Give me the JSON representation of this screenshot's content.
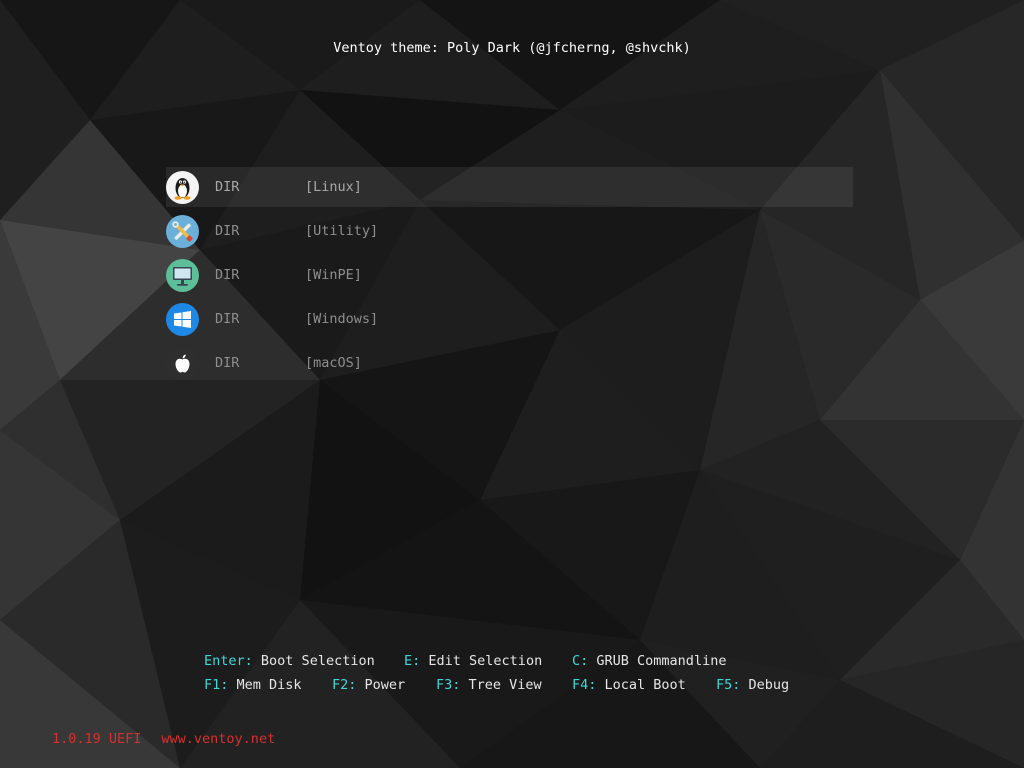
{
  "theme_title": "Ventoy theme: Poly Dark (@jfcherng, @shvchk)",
  "menu": {
    "items": [
      {
        "type": "DIR",
        "name": "[Linux]",
        "icon": "linux-tux-icon",
        "selected": true
      },
      {
        "type": "DIR",
        "name": "[Utility]",
        "icon": "tools-icon",
        "selected": false
      },
      {
        "type": "DIR",
        "name": "[WinPE]",
        "icon": "monitor-icon",
        "selected": false
      },
      {
        "type": "DIR",
        "name": "[Windows]",
        "icon": "windows-logo-icon",
        "selected": false
      },
      {
        "type": "DIR",
        "name": "[macOS]",
        "icon": "apple-logo-icon",
        "selected": false
      }
    ]
  },
  "hotkeys": {
    "row1": [
      {
        "key": "Enter:",
        "label": "Boot Selection"
      },
      {
        "key": "E:",
        "label": "Edit Selection"
      },
      {
        "key": "C:",
        "label": "GRUB Commandline"
      }
    ],
    "row2": [
      {
        "key": "F1:",
        "label": "Mem Disk"
      },
      {
        "key": "F2:",
        "label": "Power"
      },
      {
        "key": "F3:",
        "label": "Tree View"
      },
      {
        "key": "F4:",
        "label": "Local Boot"
      },
      {
        "key": "F5:",
        "label": "Debug"
      }
    ]
  },
  "footer": {
    "version": "1.0.19 UEFI",
    "website": "www.ventoy.net"
  },
  "colors": {
    "hotkey_key": "#3fd7d7",
    "hotkey_label": "#e6e6e6",
    "footer": "#d63030",
    "menu_text": "#8e8e8e"
  }
}
